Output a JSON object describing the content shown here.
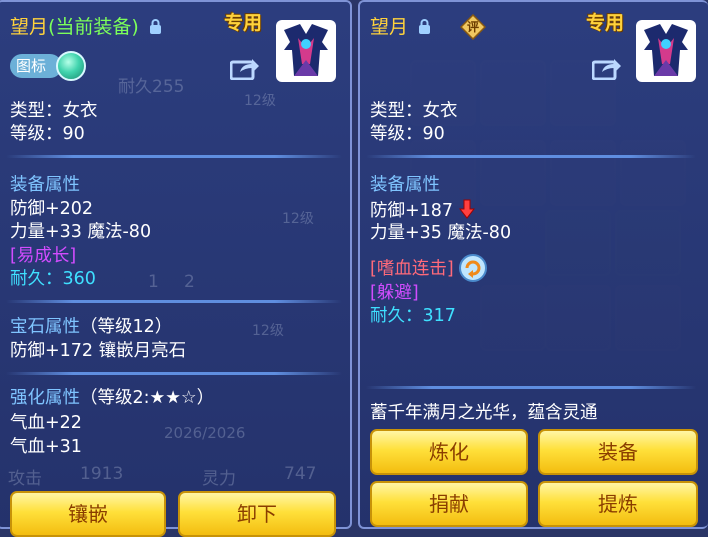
{
  "left_panel": {
    "item_name": "望月",
    "current_tag": "(当前装备)",
    "exclusive_badge": "专用",
    "toggle_label": "图标",
    "type_line": "类型：女衣",
    "level_line": "等级：90",
    "equip_attr_header": "装备属性",
    "defense": "防御+202",
    "str_magic": "力量+33 魔法-80",
    "special_tag": "[易成长]",
    "durability_label": "耐久：",
    "durability_value": "360",
    "gem_header": "宝石属性",
    "gem_sub": "（等级12）",
    "gem_line": "防御+172 镶嵌月亮石",
    "enhance_header": "强化属性",
    "enhance_sub": "（等级2:★★☆）",
    "hp_line_1": "气血+22",
    "hp_line_2": "气血+31",
    "buttons": {
      "inlay": "镶嵌",
      "unequip": "卸下"
    }
  },
  "right_panel": {
    "item_name": "望月",
    "rate_badge": "评",
    "exclusive_badge": "专用",
    "type_line": "类型：女衣",
    "level_line": "等级：90",
    "equip_attr_header": "装备属性",
    "defense": "防御+187",
    "str_magic": "力量+35 魔法-80",
    "skill_tag": "[嗜血连击]",
    "special_tag": "[躲避]",
    "durability_label": "耐久：",
    "durability_value": "317",
    "description": "蓄千年满月之光华，蕴含灵通",
    "buttons": {
      "refine": "炼化",
      "equip": "装备",
      "donate": "捐献",
      "extract": "提炼"
    }
  },
  "background_text": {
    "durability_ghost": "耐久255",
    "level_ghost_1": "12级",
    "level_ghost_2": "12级",
    "level_ghost_3": "12级",
    "tab_1": "1",
    "tab_2": "2",
    "hp_ghost": "2026/2026",
    "attack_label": "攻击",
    "attack_value": "1913",
    "spirit_label": "灵力",
    "spirit_value": "747"
  },
  "colors": {
    "panel_bg": "#2c3e80",
    "gold": "#ffd23c",
    "green_tag": "#7cff5a",
    "header_blue": "#7fc4ff",
    "purple_tag": "#d24cff",
    "red_tag": "#ff6a7a",
    "cyan_value": "#3fe0ff",
    "button_yellow": "#ffe03a"
  },
  "icons": [
    "lock-icon",
    "share-icon",
    "rating-badge-icon",
    "down-arrow-icon",
    "skill-refresh-icon",
    "character-avatar-icon"
  ]
}
